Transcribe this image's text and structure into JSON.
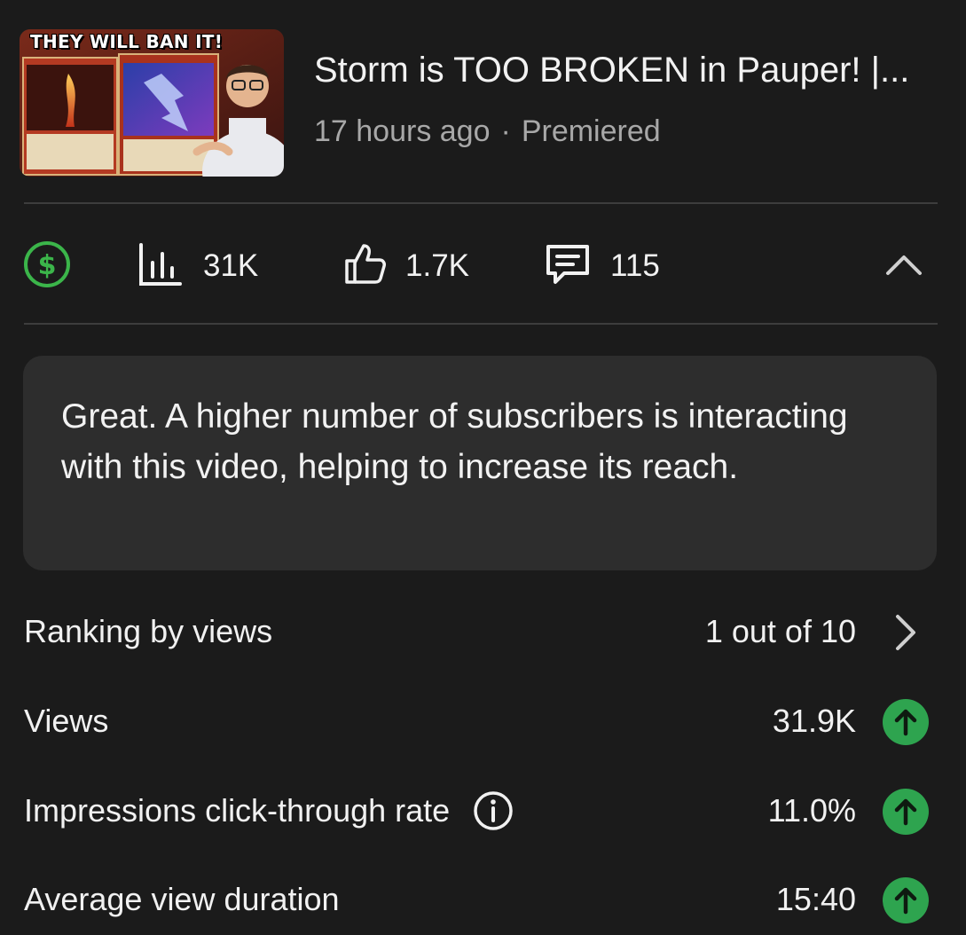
{
  "video": {
    "thumbnail_text": "THEY WILL BAN IT!",
    "title": "Storm is TOO BROKEN in Pauper! |...",
    "age": "17 hours ago",
    "separator": "·",
    "status": "Premiered"
  },
  "stats": {
    "monetization_icon": "dollar-circle-icon",
    "views": "31K",
    "likes": "1.7K",
    "comments": "115",
    "accent_green": "#3bb54a"
  },
  "info_card": {
    "text": "Great. A higher number of subscribers is interacting with this video, helping to increase its reach."
  },
  "metrics": {
    "ranking": {
      "label": "Ranking by views",
      "value": "1 out of 10"
    },
    "views": {
      "label": "Views",
      "value": "31.9K",
      "trend": "up"
    },
    "ctr": {
      "label": "Impressions click-through rate",
      "value": "11.0%",
      "trend": "up"
    },
    "avd": {
      "label": "Average view duration",
      "value": "15:40",
      "trend": "up"
    }
  },
  "colors": {
    "background": "#1b1b1b",
    "card": "#2d2d2d",
    "trend_up": "#2ea44f",
    "muted_text": "#a8a8a8"
  }
}
